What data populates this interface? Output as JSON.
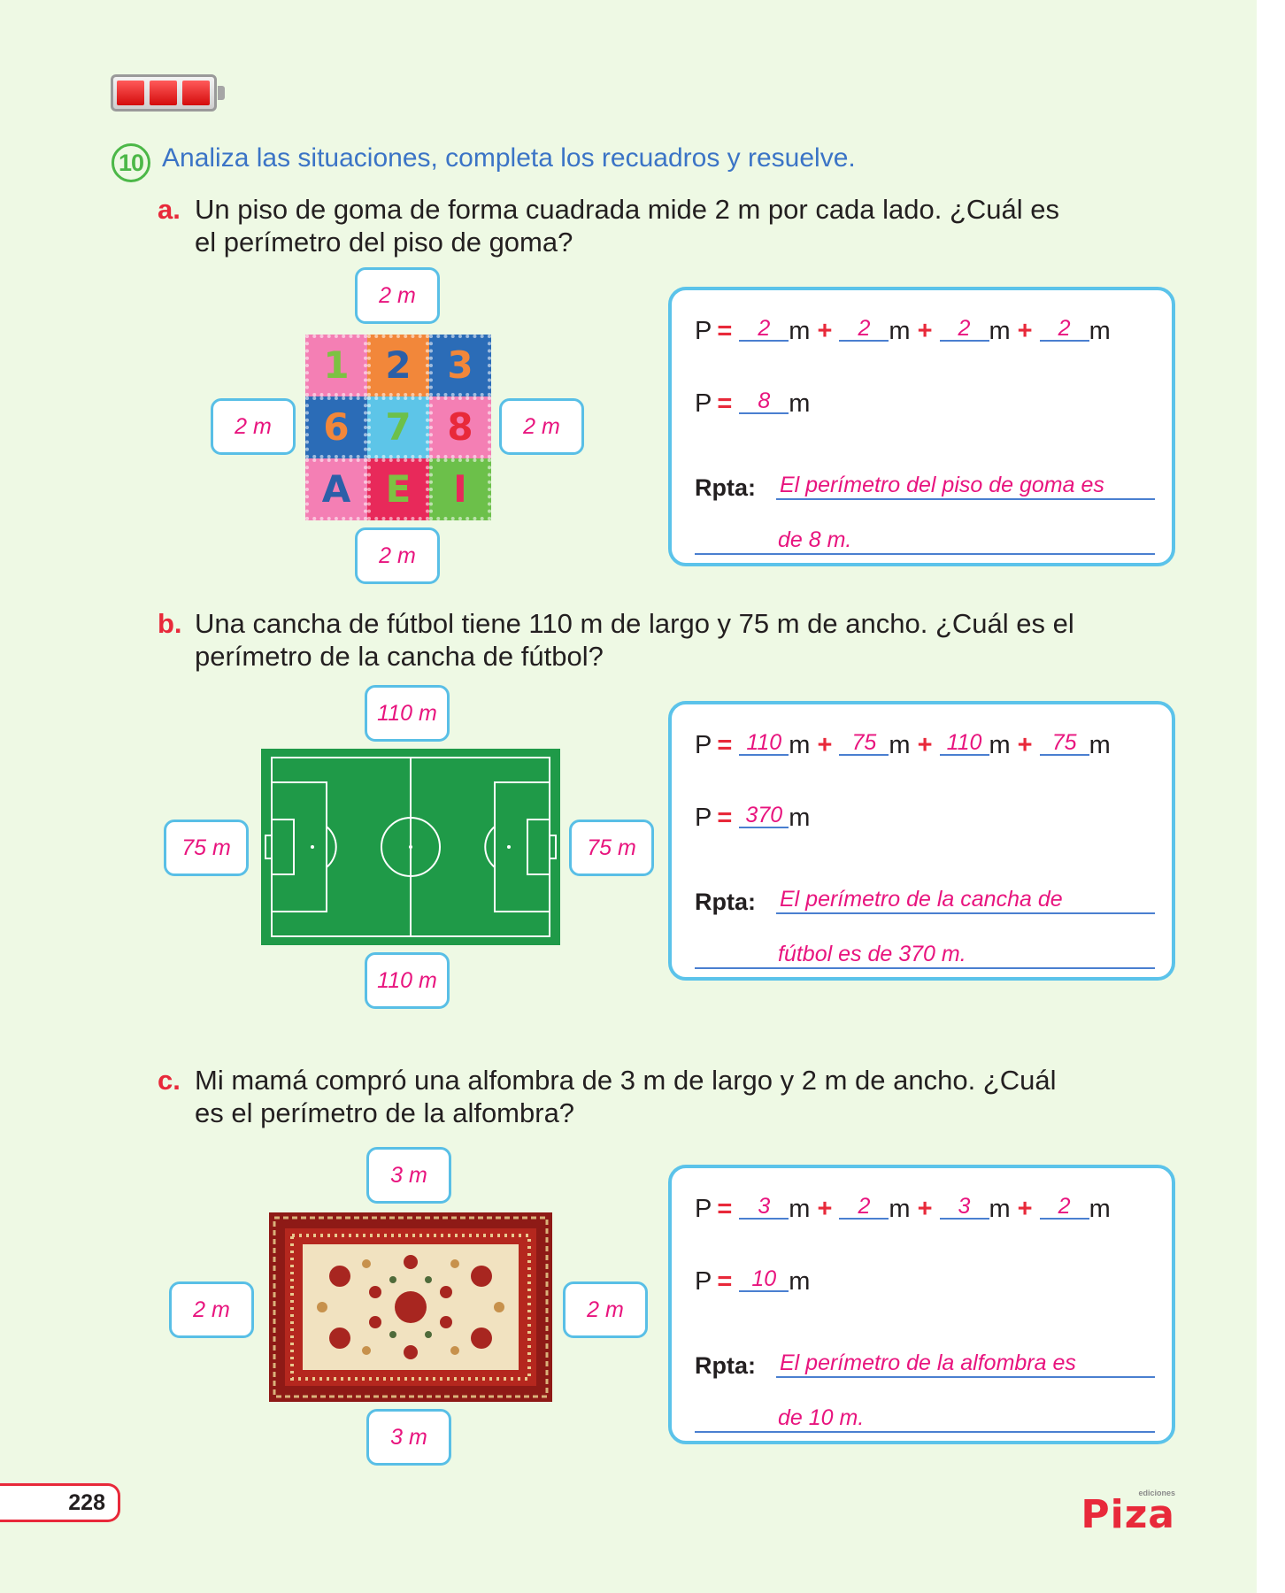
{
  "question": {
    "number": "10",
    "instruction": "Analiza las situaciones, completa los recuadros y resuelve."
  },
  "items": [
    {
      "letter": "a.",
      "text_line1": "Un piso de goma de forma cuadrada mide 2 m por cada lado. ¿Cuál es",
      "text_line2": "el perímetro del piso de goma?",
      "labels": {
        "top": "2 m",
        "left": "2 m",
        "right": "2 m",
        "bottom": "2 m"
      },
      "blanks": [
        "2",
        "2",
        "2",
        "2"
      ],
      "total": "8",
      "answer_line1": "El perímetro del piso de goma es",
      "answer_line2": "de 8 m.",
      "image_labels": [
        "1",
        "2",
        "3",
        "6",
        "7",
        "8",
        "A",
        "E",
        "I"
      ]
    },
    {
      "letter": "b.",
      "text_line1": "Una cancha de fútbol tiene 110 m de largo y 75 m de ancho. ¿Cuál es el",
      "text_line2": "perímetro de la cancha de fútbol?",
      "labels": {
        "top": "110 m",
        "left": "75 m",
        "right": "75 m",
        "bottom": "110 m"
      },
      "blanks": [
        "110",
        "75",
        "110",
        "75"
      ],
      "total": "370",
      "answer_line1": "El perímetro de la cancha de",
      "answer_line2": "fútbol es de 370 m."
    },
    {
      "letter": "c.",
      "text_line1": "Mi mamá compró una alfombra de 3 m de largo y 2 m de ancho.  ¿Cuál",
      "text_line2": "es el perímetro de la alfombra?",
      "labels": {
        "top": "3 m",
        "left": "2 m",
        "right": "2 m",
        "bottom": "3 m"
      },
      "blanks": [
        "3",
        "2",
        "3",
        "2"
      ],
      "total": "10",
      "answer_line1": "El perímetro de la alfombra es",
      "answer_line2": "de 10 m."
    }
  ],
  "common": {
    "p": "P",
    "eq": "=",
    "plus": "+",
    "unit": "m",
    "rpta": "Rpta:"
  },
  "footer": {
    "page_number": "228",
    "logo_small": "ediciones",
    "logo_big": "Piza"
  },
  "colors": {
    "background": "#eef9e4",
    "accent_red": "#e8293a",
    "answer_pink": "#e8147e",
    "box_blue": "#5bc3ea",
    "instruction_blue": "#3b74c6",
    "number_green": "#4cb848"
  }
}
